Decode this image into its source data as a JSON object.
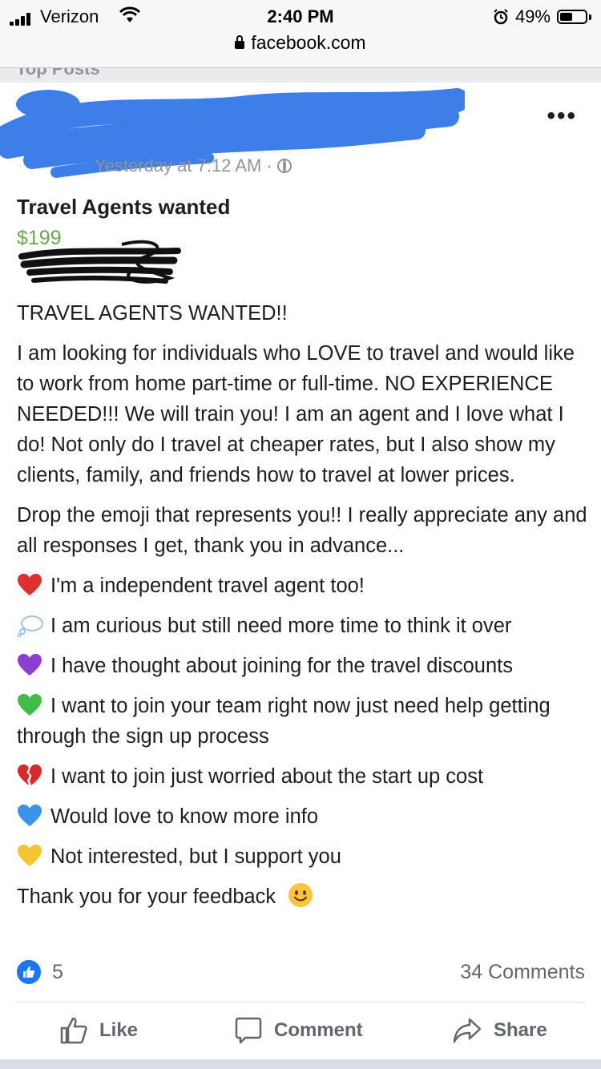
{
  "status_bar": {
    "carrier": "Verizon",
    "time": "2:40 PM",
    "battery": "49%",
    "battery_level": 0.49,
    "url": "facebook.com"
  },
  "section_header": "Top Posts",
  "post": {
    "timestamp": "Yesterday at 7:12 AM ·",
    "privacy_icon": "globe-icon",
    "more_label": "•••",
    "title": "Travel Agents wanted",
    "price": "$199",
    "price_color": "#6aa84f",
    "headline": "TRAVEL AGENTS WANTED!!",
    "paragraph1": "I am looking for individuals who LOVE to travel and would like to work from home part-time or full-time. NO EXPERIENCE NEEDED!!! We will train you! I am an agent and I love what I do! Not only do I travel at cheaper rates, but I also show my clients, family, and friends how to travel at lower prices.",
    "paragraph2": "Drop the emoji that represents you!! I really appreciate any and all responses I get, thank you in advance...",
    "options": [
      {
        "emoji": "red-heart",
        "text": "I'm a independent travel agent too!"
      },
      {
        "emoji": "thought-balloon",
        "text": "I am curious but still need more time to think it over"
      },
      {
        "emoji": "purple-heart",
        "text": "I have thought about joining for the travel discounts"
      },
      {
        "emoji": "green-heart",
        "text": "I want to join your team right now just need help getting through the sign up process"
      },
      {
        "emoji": "broken-heart",
        "text": "I want to join just worried about the start up cost"
      },
      {
        "emoji": "blue-heart",
        "text": "Would love to know more info"
      },
      {
        "emoji": "yellow-heart",
        "text": "Not interested, but I support you"
      }
    ],
    "closing": "Thank you for your feedback"
  },
  "reactions": {
    "like_count": "5",
    "comments": "34 Comments"
  },
  "actions": {
    "like": "Like",
    "comment": "Comment",
    "share": "Share"
  },
  "colors": {
    "facebook_blue": "#1877f2",
    "scribble_blue": "#3d7ee8"
  }
}
